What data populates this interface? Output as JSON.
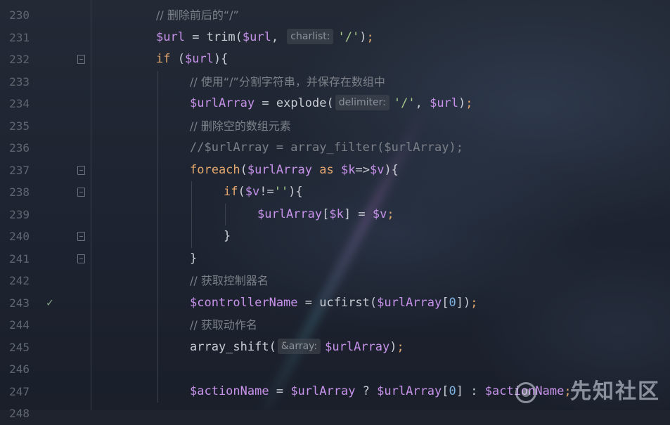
{
  "editor": {
    "lines": [
      {
        "num": "230",
        "mark": "",
        "fold": false
      },
      {
        "num": "231",
        "mark": "",
        "fold": false
      },
      {
        "num": "232",
        "mark": "",
        "fold": true
      },
      {
        "num": "233",
        "mark": "",
        "fold": false
      },
      {
        "num": "234",
        "mark": "",
        "fold": false
      },
      {
        "num": "235",
        "mark": "",
        "fold": false
      },
      {
        "num": "236",
        "mark": "",
        "fold": false
      },
      {
        "num": "237",
        "mark": "",
        "fold": true
      },
      {
        "num": "238",
        "mark": "",
        "fold": true
      },
      {
        "num": "239",
        "mark": "",
        "fold": false
      },
      {
        "num": "240",
        "mark": "",
        "fold": true
      },
      {
        "num": "241",
        "mark": "",
        "fold": true
      },
      {
        "num": "242",
        "mark": "",
        "fold": false
      },
      {
        "num": "243",
        "mark": "✓",
        "fold": false
      },
      {
        "num": "244",
        "mark": "",
        "fold": false
      },
      {
        "num": "245",
        "mark": "",
        "fold": false
      },
      {
        "num": "246",
        "mark": "",
        "fold": false
      },
      {
        "num": "247",
        "mark": "",
        "fold": false
      },
      {
        "num": "248",
        "mark": "",
        "fold": false
      }
    ],
    "code": {
      "l230_comment": "// 删除前后的“/”",
      "l231_var": "$url",
      "l231_eq": " = ",
      "l231_fn": "trim(",
      "l231_arg": "$url",
      "l231_comma": ", ",
      "l231_hint": "charlist:",
      "l231_str": "'/'",
      "l231_close": ")",
      "l231_semi": ";",
      "l232_kw": "if",
      "l232_open": " (",
      "l232_var": "$url",
      "l232_close": "){",
      "l233_comment": "// 使用“/”分割字符串，并保存在数组中",
      "l234_var": "$urlArray",
      "l234_eq": " = ",
      "l234_fn": "explode(",
      "l234_hint": "delimiter:",
      "l234_str": "'/'",
      "l234_comma": ", ",
      "l234_arg": "$url",
      "l234_close": ")",
      "l234_semi": ";",
      "l235_comment": "// 删除空的数组元素",
      "l236_comment": "//$urlArray = array_filter($urlArray);",
      "l237_kw": "foreach",
      "l237_open": "(",
      "l237_var": "$urlArray",
      "l237_as": " as ",
      "l237_k": "$k",
      "l237_arrow": "=>",
      "l237_v": "$v",
      "l237_close": "){",
      "l238_kw": "if",
      "l238_open": "(",
      "l238_v": "$v",
      "l238_op": "!=",
      "l238_str": "''",
      "l238_close": "){",
      "l239_var": "$urlArray",
      "l239_lb": "[",
      "l239_k": "$k",
      "l239_rb": "]",
      "l239_eq": " = ",
      "l239_v": "$v",
      "l239_semi": ";",
      "l240_brace": "}",
      "l241_brace": "}",
      "l242_comment": "// 获取控制器名",
      "l243_var": "$controllerName",
      "l243_eq": " = ",
      "l243_fn": "ucfirst(",
      "l243_arg": "$urlArray",
      "l243_lb": "[",
      "l243_num": "0",
      "l243_rb": "])",
      "l243_semi": ";",
      "l244_comment": "// 获取动作名",
      "l245_fn": "array_shift(",
      "l245_hint": "&array:",
      "l245_arg": "$urlArray",
      "l245_close": ")",
      "l245_semi": ";",
      "l247_var": "$actionName",
      "l247_eq": " = ",
      "l247_arg": "$urlArray",
      "l247_q": " ? ",
      "l247_arg2": "$urlArray",
      "l247_lb": "[",
      "l247_num": "0",
      "l247_rb": "]",
      "l247_colon": " : ",
      "l247_arg3": "$actionName",
      "l247_semi": ";"
    }
  },
  "watermark": {
    "text": "先知社区"
  },
  "colors": {
    "background": "#1f232d",
    "variable": "#c792ea",
    "keyword": "#e3a76d",
    "string": "#a6c98a",
    "number": "#7fb2e0",
    "comment": "#7c8088"
  }
}
